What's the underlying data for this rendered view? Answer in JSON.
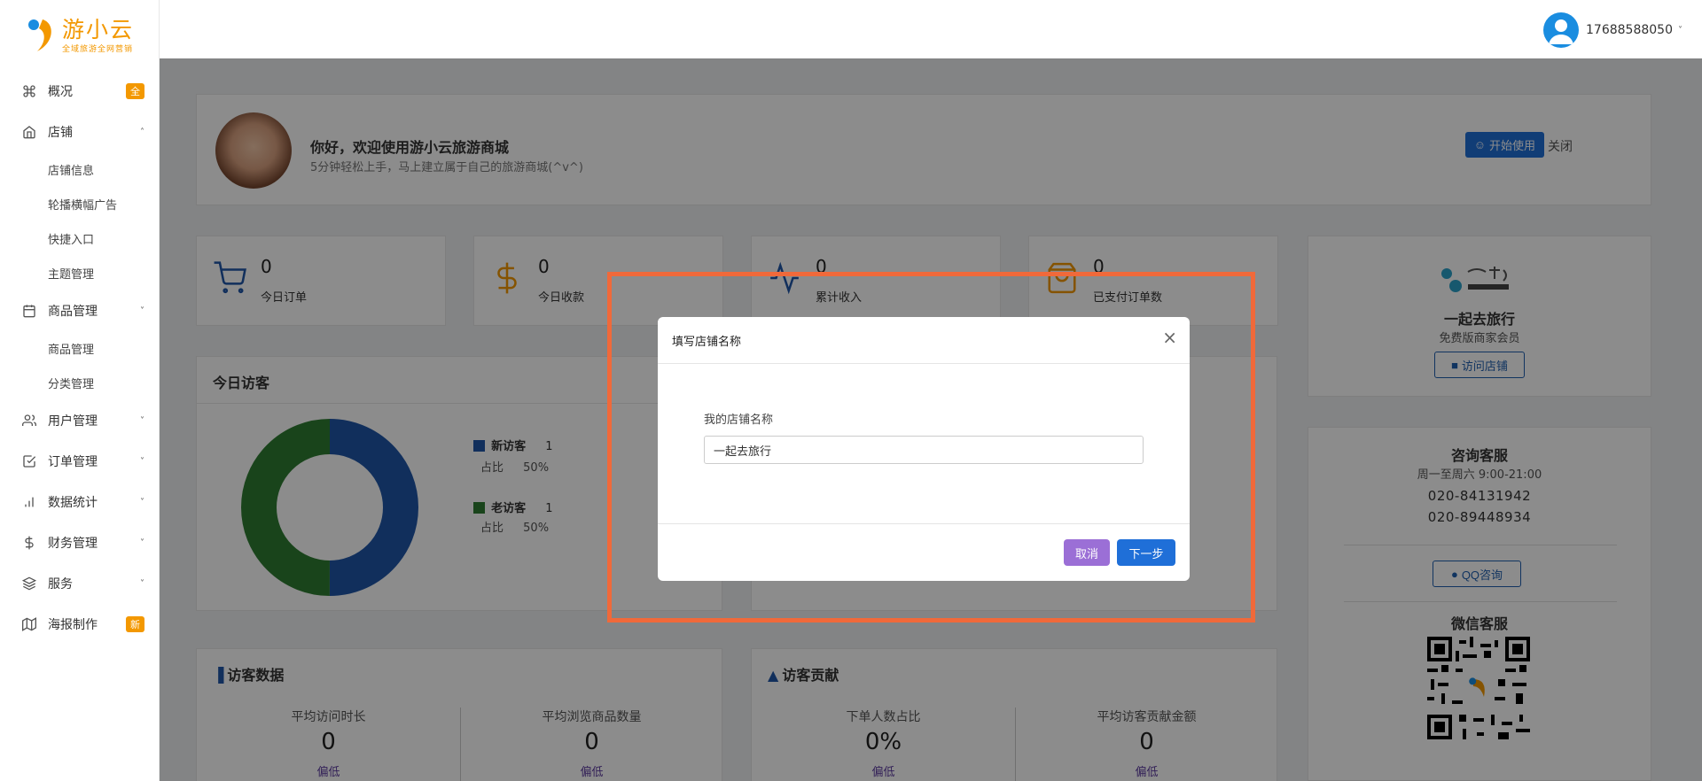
{
  "brand": {
    "name": "游小云",
    "tagline": "全域旅游全网营销",
    "accent_color": "#f39800"
  },
  "header": {
    "user_phone": "17688588050"
  },
  "sidebar": {
    "items": [
      {
        "label": "概况",
        "icon": "command-icon",
        "badge": "全"
      },
      {
        "label": "店铺",
        "icon": "home-icon",
        "expanded": true,
        "children": [
          "店铺信息",
          "轮播横幅广告",
          "快捷入口",
          "主题管理"
        ]
      },
      {
        "label": "商品管理",
        "icon": "calendar-icon",
        "expanded": true,
        "children": [
          "商品管理",
          "分类管理"
        ]
      },
      {
        "label": "用户管理",
        "icon": "users-icon"
      },
      {
        "label": "订单管理",
        "icon": "check-square-icon"
      },
      {
        "label": "数据统计",
        "icon": "bar-chart-icon"
      },
      {
        "label": "财务管理",
        "icon": "dollar-icon"
      },
      {
        "label": "服务",
        "icon": "layers-icon"
      },
      {
        "label": "海报制作",
        "icon": "map-icon",
        "badge": "新"
      }
    ]
  },
  "welcome": {
    "title": "你好，欢迎使用游小云旅游商城",
    "subtitle": "5分钟轻松上手，马上建立属于自己的旅游商城(^v^)",
    "start_button": "开始使用",
    "close_label": "关闭"
  },
  "stats": [
    {
      "value": "0",
      "label": "今日订单",
      "icon": "cart-icon"
    },
    {
      "value": "0",
      "label": "今日收款",
      "icon": "dollar-icon"
    },
    {
      "value": "0",
      "label": "累计收入",
      "icon": "activity-icon"
    },
    {
      "value": "0",
      "label": "已支付订单数",
      "icon": "bag-icon"
    }
  ],
  "today_visitors": {
    "title": "今日访客",
    "new_label": "新访客",
    "new_count": "1",
    "new_ratio_label": "占比",
    "new_ratio": "50%",
    "old_label": "老访客",
    "old_count": "1",
    "old_ratio_label": "占比",
    "old_ratio": "50%",
    "new_color": "#1f56a8",
    "old_color": "#2e7d32"
  },
  "store": {
    "name": "一起去旅行",
    "level": "免费版商家会员",
    "visit_button": "访问店铺"
  },
  "service": {
    "title": "咨询客服",
    "hours": "周一至周六 9:00-21:00",
    "phone1": "020-84131942",
    "phone2": "020-89448934",
    "qq_button": "QQ咨询",
    "wechat_title": "微信客服"
  },
  "visitor_data": {
    "title": "访客数据",
    "col1_label": "平均访问时长",
    "col1_value": "0",
    "col1_hint": "偏低",
    "col2_label": "平均浏览商品数量",
    "col2_value": "0",
    "col2_hint": "偏低"
  },
  "visitor_contrib": {
    "title": "访客贡献",
    "col1_label": "下单人数占比",
    "col1_value": "0%",
    "col1_hint": "偏低",
    "col2_label": "平均访客贡献金额",
    "col2_value": "0",
    "col2_hint": "偏低"
  },
  "modal": {
    "title": "填写店铺名称",
    "field_label": "我的店铺名称",
    "field_value": "一起去旅行",
    "cancel_button": "取消",
    "next_button": "下一步"
  },
  "colors": {
    "primary": "#1f6fd8",
    "cancel": "#9b6fd6",
    "highlight": "#f0693a"
  }
}
